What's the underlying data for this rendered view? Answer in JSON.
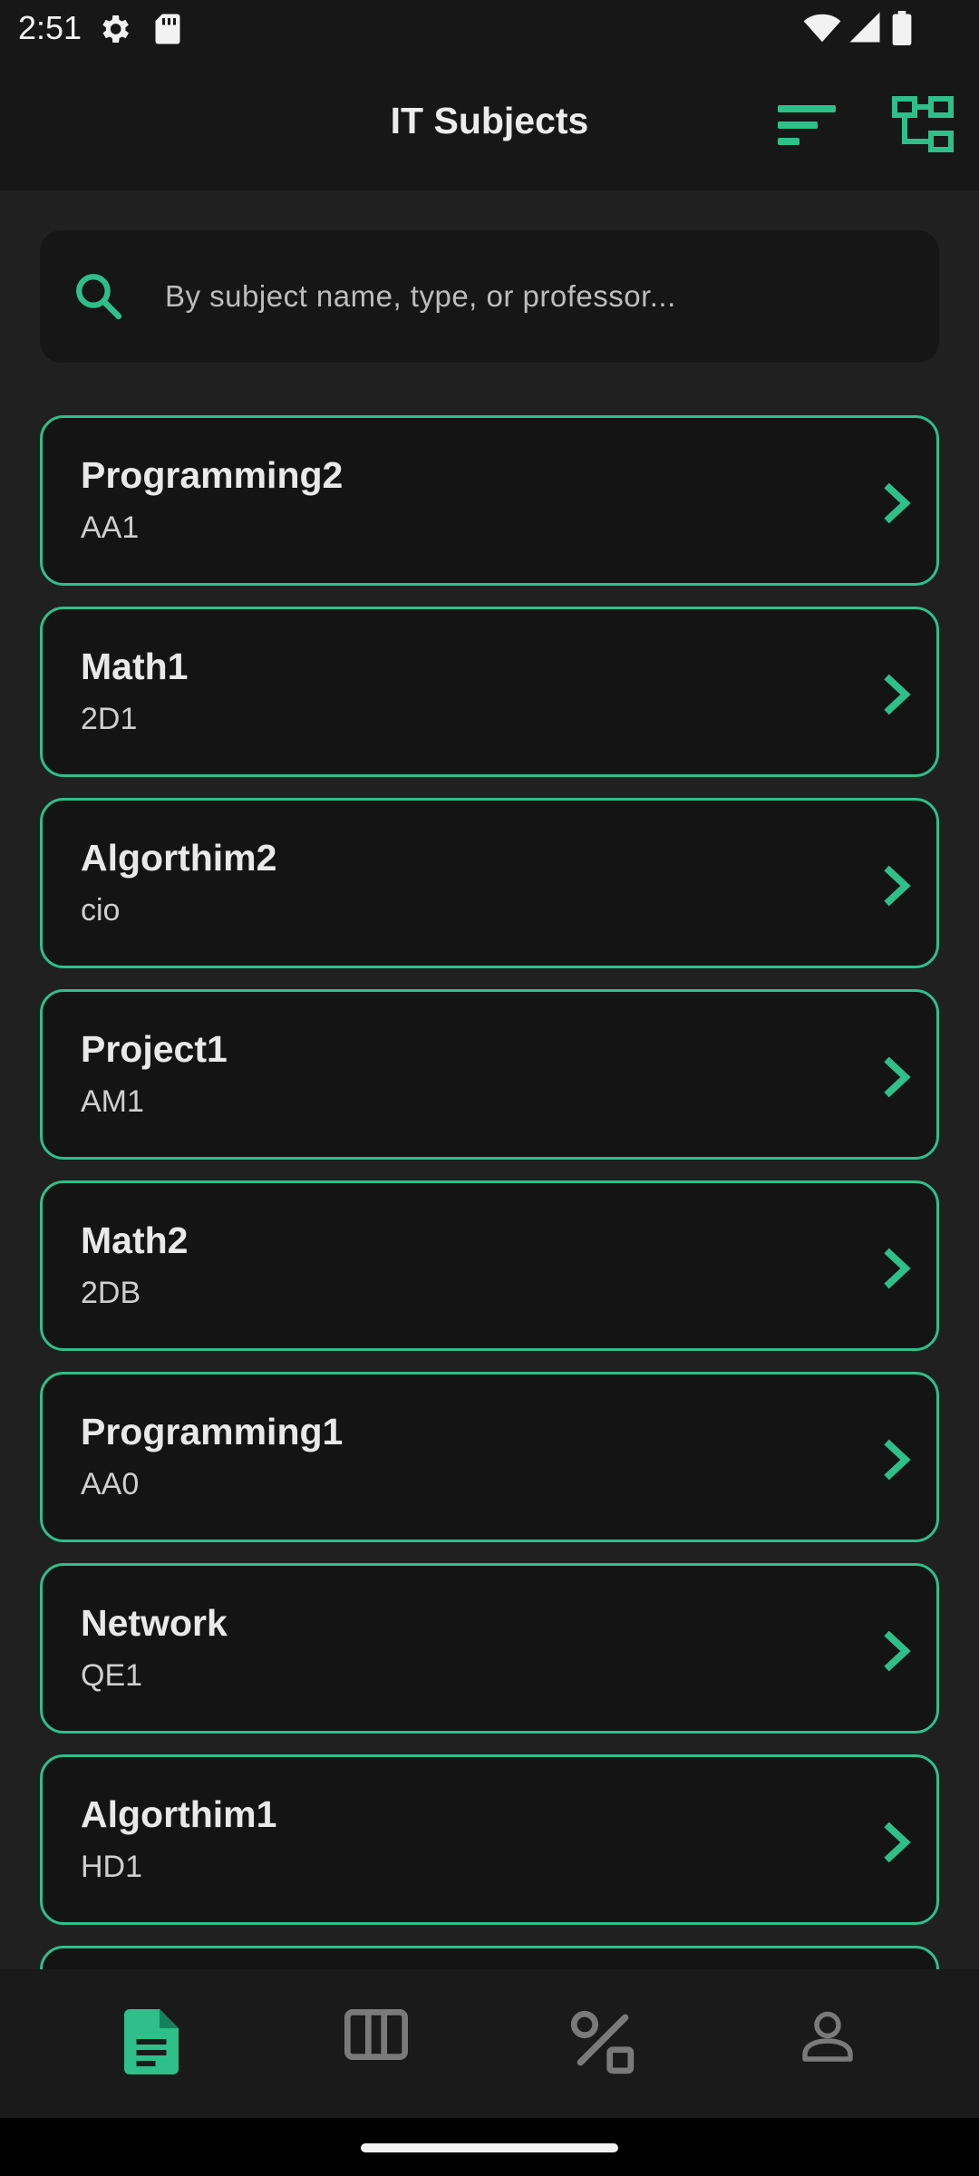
{
  "status_bar": {
    "time": "2:51",
    "icons": [
      "gear-icon",
      "sd-card-icon",
      "wifi-icon",
      "signal-icon",
      "battery-icon"
    ]
  },
  "app_bar": {
    "title": "IT Subjects",
    "actions": [
      "sort-icon",
      "tree-icon"
    ]
  },
  "search": {
    "placeholder": "By subject name, type, or professor..."
  },
  "subjects": [
    {
      "name": "Programming2",
      "code": "AA1"
    },
    {
      "name": "Math1",
      "code": "2D1"
    },
    {
      "name": "Algorthim2",
      "code": "cio"
    },
    {
      "name": "Project1",
      "code": "AM1"
    },
    {
      "name": "Math2",
      "code": "2DB"
    },
    {
      "name": "Programming1",
      "code": "AA0"
    },
    {
      "name": "Network",
      "code": "QE1"
    },
    {
      "name": "Algorthim1",
      "code": "HD1"
    }
  ],
  "bottom_nav": {
    "items": [
      "document-icon",
      "columns-icon",
      "path-icon",
      "profile-icon"
    ],
    "active": "document-icon"
  },
  "colors": {
    "accent": "#2ebf8b",
    "background": "#202020",
    "bar": "#171717"
  }
}
